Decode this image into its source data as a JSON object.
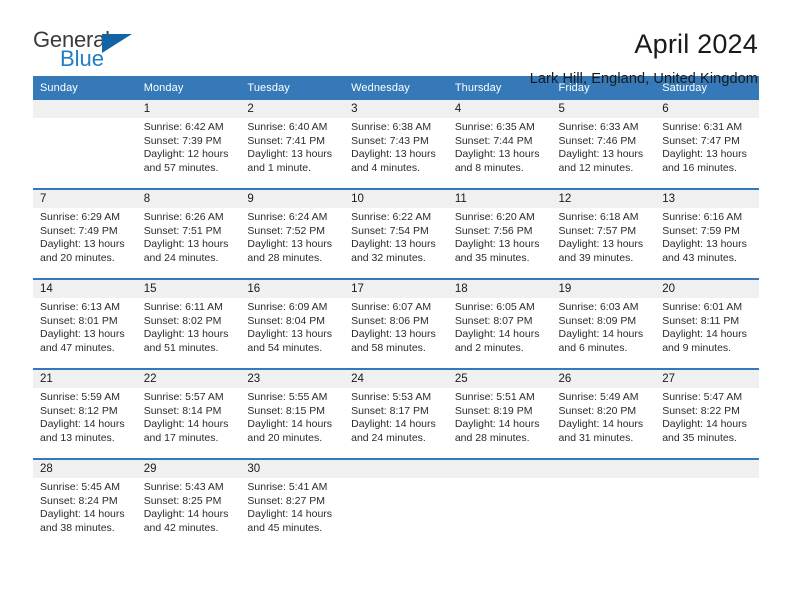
{
  "brand": {
    "name_top": "General",
    "name_bottom": "Blue",
    "triangle_icon": "triangle-icon",
    "top_color": "#3b3b3b",
    "bottom_color": "#1f7fc4",
    "triangle_color": "#1464a5"
  },
  "header": {
    "title": "April 2024",
    "subtitle": "Lark Hill, England, United Kingdom"
  },
  "theme": {
    "header_bg": "#3579b8",
    "header_text": "#ffffff",
    "daynum_bg": "#f0f0f0",
    "row_divider": "#3579b8",
    "body_text": "#2b2b2b"
  },
  "calendar": {
    "columns": [
      "Sunday",
      "Monday",
      "Tuesday",
      "Wednesday",
      "Thursday",
      "Friday",
      "Saturday"
    ],
    "weeks": [
      [
        {
          "day": "",
          "info": ""
        },
        {
          "day": "1",
          "info": "Sunrise: 6:42 AM\nSunset: 7:39 PM\nDaylight: 12 hours and 57 minutes."
        },
        {
          "day": "2",
          "info": "Sunrise: 6:40 AM\nSunset: 7:41 PM\nDaylight: 13 hours and 1 minute."
        },
        {
          "day": "3",
          "info": "Sunrise: 6:38 AM\nSunset: 7:43 PM\nDaylight: 13 hours and 4 minutes."
        },
        {
          "day": "4",
          "info": "Sunrise: 6:35 AM\nSunset: 7:44 PM\nDaylight: 13 hours and 8 minutes."
        },
        {
          "day": "5",
          "info": "Sunrise: 6:33 AM\nSunset: 7:46 PM\nDaylight: 13 hours and 12 minutes."
        },
        {
          "day": "6",
          "info": "Sunrise: 6:31 AM\nSunset: 7:47 PM\nDaylight: 13 hours and 16 minutes."
        }
      ],
      [
        {
          "day": "7",
          "info": "Sunrise: 6:29 AM\nSunset: 7:49 PM\nDaylight: 13 hours and 20 minutes."
        },
        {
          "day": "8",
          "info": "Sunrise: 6:26 AM\nSunset: 7:51 PM\nDaylight: 13 hours and 24 minutes."
        },
        {
          "day": "9",
          "info": "Sunrise: 6:24 AM\nSunset: 7:52 PM\nDaylight: 13 hours and 28 minutes."
        },
        {
          "day": "10",
          "info": "Sunrise: 6:22 AM\nSunset: 7:54 PM\nDaylight: 13 hours and 32 minutes."
        },
        {
          "day": "11",
          "info": "Sunrise: 6:20 AM\nSunset: 7:56 PM\nDaylight: 13 hours and 35 minutes."
        },
        {
          "day": "12",
          "info": "Sunrise: 6:18 AM\nSunset: 7:57 PM\nDaylight: 13 hours and 39 minutes."
        },
        {
          "day": "13",
          "info": "Sunrise: 6:16 AM\nSunset: 7:59 PM\nDaylight: 13 hours and 43 minutes."
        }
      ],
      [
        {
          "day": "14",
          "info": "Sunrise: 6:13 AM\nSunset: 8:01 PM\nDaylight: 13 hours and 47 minutes."
        },
        {
          "day": "15",
          "info": "Sunrise: 6:11 AM\nSunset: 8:02 PM\nDaylight: 13 hours and 51 minutes."
        },
        {
          "day": "16",
          "info": "Sunrise: 6:09 AM\nSunset: 8:04 PM\nDaylight: 13 hours and 54 minutes."
        },
        {
          "day": "17",
          "info": "Sunrise: 6:07 AM\nSunset: 8:06 PM\nDaylight: 13 hours and 58 minutes."
        },
        {
          "day": "18",
          "info": "Sunrise: 6:05 AM\nSunset: 8:07 PM\nDaylight: 14 hours and 2 minutes."
        },
        {
          "day": "19",
          "info": "Sunrise: 6:03 AM\nSunset: 8:09 PM\nDaylight: 14 hours and 6 minutes."
        },
        {
          "day": "20",
          "info": "Sunrise: 6:01 AM\nSunset: 8:11 PM\nDaylight: 14 hours and 9 minutes."
        }
      ],
      [
        {
          "day": "21",
          "info": "Sunrise: 5:59 AM\nSunset: 8:12 PM\nDaylight: 14 hours and 13 minutes."
        },
        {
          "day": "22",
          "info": "Sunrise: 5:57 AM\nSunset: 8:14 PM\nDaylight: 14 hours and 17 minutes."
        },
        {
          "day": "23",
          "info": "Sunrise: 5:55 AM\nSunset: 8:15 PM\nDaylight: 14 hours and 20 minutes."
        },
        {
          "day": "24",
          "info": "Sunrise: 5:53 AM\nSunset: 8:17 PM\nDaylight: 14 hours and 24 minutes."
        },
        {
          "day": "25",
          "info": "Sunrise: 5:51 AM\nSunset: 8:19 PM\nDaylight: 14 hours and 28 minutes."
        },
        {
          "day": "26",
          "info": "Sunrise: 5:49 AM\nSunset: 8:20 PM\nDaylight: 14 hours and 31 minutes."
        },
        {
          "day": "27",
          "info": "Sunrise: 5:47 AM\nSunset: 8:22 PM\nDaylight: 14 hours and 35 minutes."
        }
      ],
      [
        {
          "day": "28",
          "info": "Sunrise: 5:45 AM\nSunset: 8:24 PM\nDaylight: 14 hours and 38 minutes."
        },
        {
          "day": "29",
          "info": "Sunrise: 5:43 AM\nSunset: 8:25 PM\nDaylight: 14 hours and 42 minutes."
        },
        {
          "day": "30",
          "info": "Sunrise: 5:41 AM\nSunset: 8:27 PM\nDaylight: 14 hours and 45 minutes."
        },
        {
          "day": "",
          "info": ""
        },
        {
          "day": "",
          "info": ""
        },
        {
          "day": "",
          "info": ""
        },
        {
          "day": "",
          "info": ""
        }
      ]
    ]
  }
}
